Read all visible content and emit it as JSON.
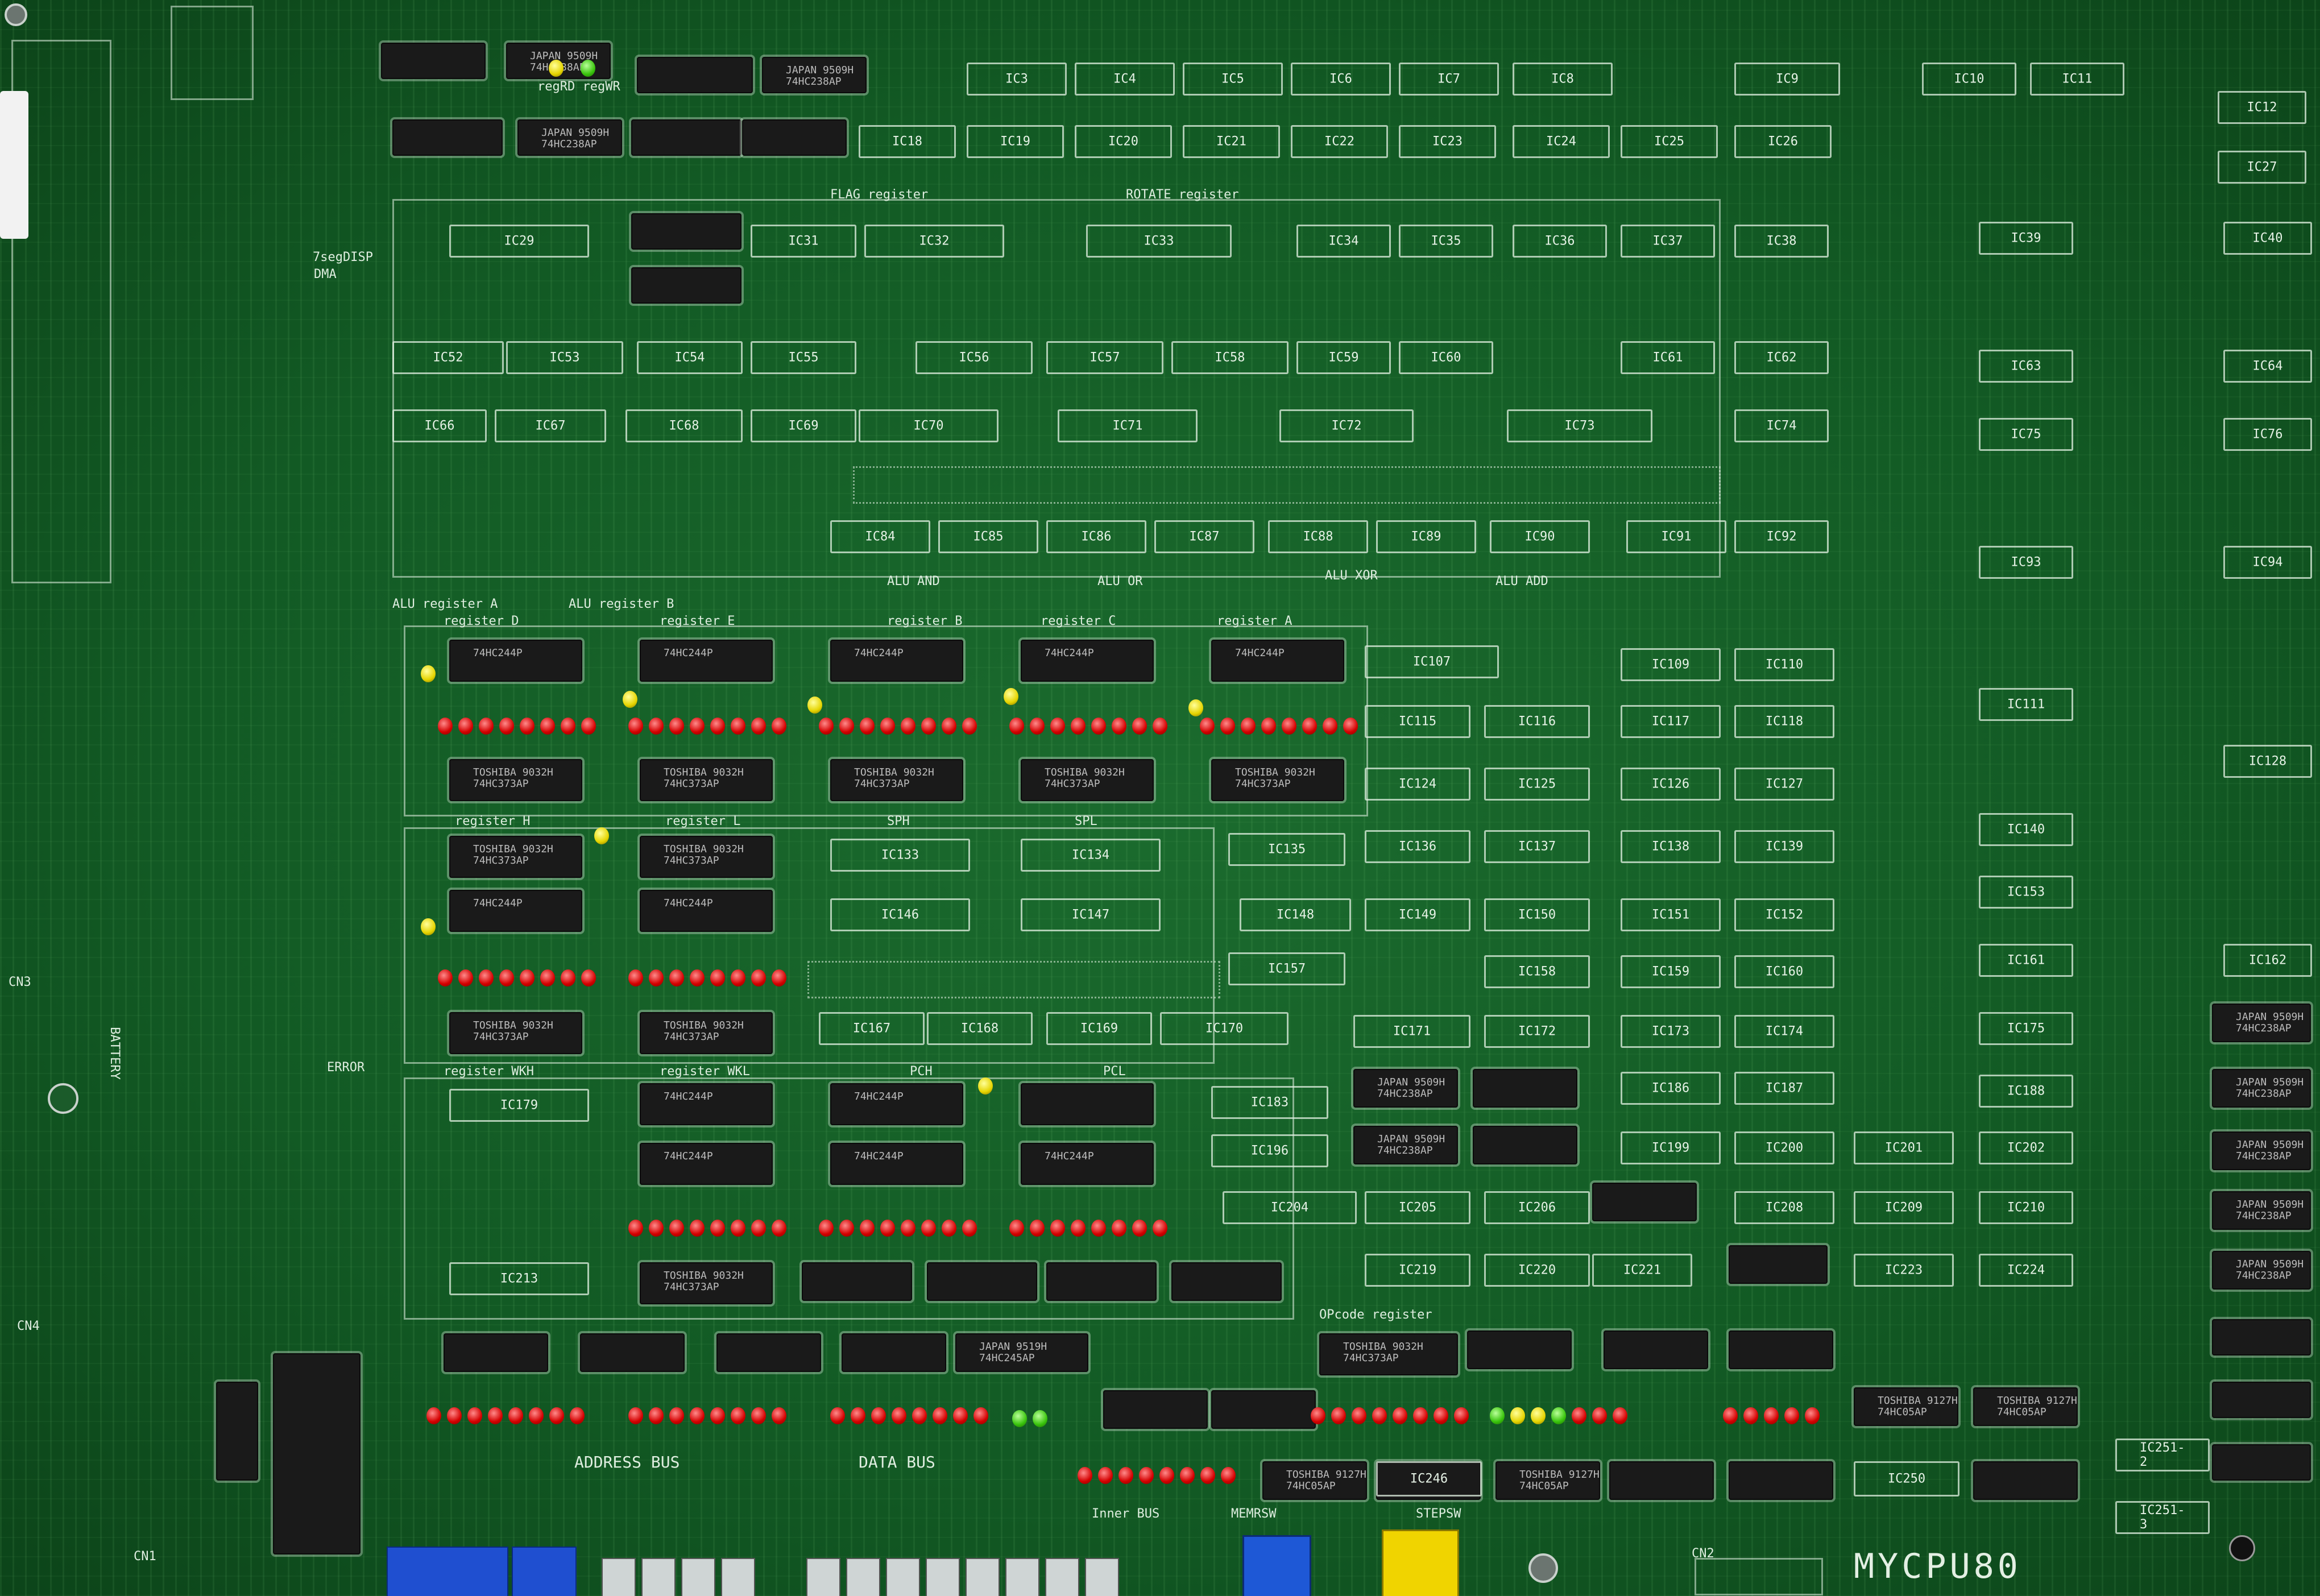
{
  "board": {
    "title": "MYCPU80",
    "labels": {
      "flag_register": "FLAG register",
      "rotate_register": "ROTATE register",
      "alu_register_a": "ALU register A",
      "alu_register_b": "ALU register B",
      "alu_and": "ALU AND",
      "alu_or": "ALU OR",
      "alu_xor": "ALU XOR",
      "alu_add": "ALU ADD",
      "register_d": "register D",
      "register_e": "register E",
      "register_b": "register B",
      "register_c": "register C",
      "register_a": "register A",
      "register_h": "register H",
      "register_l": "register L",
      "sph": "SPH",
      "spl": "SPL",
      "register_wkh": "register WKH",
      "register_wkl": "register WKL",
      "pch": "PCH",
      "pcl": "PCL",
      "opcode_register": "OPcode register",
      "address_bus": "ADDRESS BUS",
      "data_bus": "DATA BUS",
      "inner_bus": "Inner BUS",
      "memrsw": "MEMRSW",
      "stepsw": "STEPSW",
      "battery": "BATTERY",
      "error": "ERROR",
      "seven_seg": "7segDISP",
      "dma": "DMA",
      "regrd_regwr": "regRD  regWR",
      "cn1": "CN1",
      "cn2": "CN2",
      "cn3": "CN3",
      "cn4": "CN4"
    },
    "chip_marks": {
      "hc238": "JAPAN 9509H\n74HC238AP",
      "hc244": "74HC244P",
      "hc373": "TOSHIBA 9032H\n74HC373AP",
      "hc245": "JAPAN 9519H\n74HC245AP",
      "hc05": "TOSHIBA 9127H\n74HC05AP"
    },
    "ic_row_1": [
      "IC3",
      "IC4",
      "IC5",
      "IC6",
      "IC7",
      "IC8",
      "IC9",
      "IC10",
      "IC11",
      "IC12"
    ],
    "ic_row_2": [
      "IC18",
      "IC19",
      "IC20",
      "IC21",
      "IC22",
      "IC23",
      "IC24",
      "IC25",
      "IC26",
      "IC27"
    ],
    "ic_row_3": [
      "IC29",
      "IC31",
      "IC32",
      "IC33",
      "IC34",
      "IC35",
      "IC36",
      "IC37",
      "IC38",
      "IC39",
      "IC40"
    ],
    "ic_row_4": [
      "IC52",
      "IC53",
      "IC54",
      "IC55",
      "IC56",
      "IC57",
      "IC58",
      "IC59",
      "IC60",
      "IC61",
      "IC62",
      "IC63",
      "IC64"
    ],
    "ic_row_5": [
      "IC66",
      "IC67",
      "IC68",
      "IC69",
      "IC70",
      "IC71",
      "IC72",
      "IC73",
      "IC74",
      "IC75",
      "IC76"
    ],
    "ic_row_6": [
      "IC84",
      "IC85",
      "IC86",
      "IC87",
      "IC88",
      "IC89",
      "IC90",
      "IC91",
      "IC92",
      "IC93",
      "IC94"
    ],
    "ic_right_col": [
      "IC107",
      "IC109",
      "IC110",
      "IC111",
      "IC115",
      "IC116",
      "IC117",
      "IC118",
      "IC124",
      "IC125",
      "IC126",
      "IC127",
      "IC128"
    ],
    "ic_mid_col": [
      "IC133",
      "IC134",
      "IC135",
      "IC136",
      "IC137",
      "IC138",
      "IC139",
      "IC140",
      "IC146",
      "IC147",
      "IC148",
      "IC149",
      "IC150",
      "IC151",
      "IC152",
      "IC153",
      "IC157",
      "IC158",
      "IC159",
      "IC160",
      "IC161",
      "IC162"
    ],
    "ic_low_col": [
      "IC167",
      "IC168",
      "IC169",
      "IC170",
      "IC171",
      "IC172",
      "IC173",
      "IC174",
      "IC175",
      "IC179",
      "IC183",
      "IC186",
      "IC187",
      "IC188",
      "IC196",
      "IC199",
      "IC200",
      "IC201",
      "IC202",
      "IC204",
      "IC205",
      "IC206",
      "IC208",
      "IC209",
      "IC210",
      "IC213",
      "IC219",
      "IC220",
      "IC221",
      "IC223",
      "IC224"
    ],
    "ic_bottom": [
      "IC246",
      "IC250",
      "IC251-2",
      "IC251-3"
    ]
  }
}
